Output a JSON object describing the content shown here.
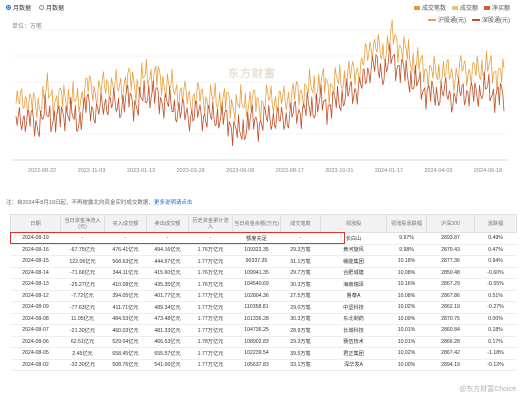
{
  "view_toggle": {
    "options": [
      "月数据",
      "月数据"
    ],
    "selected_index": 0
  },
  "legend_top": {
    "items": [
      {
        "label": "成交笔数",
        "color": "#e69a2e"
      },
      {
        "label": "成交额",
        "color": "#f0c080"
      },
      {
        "label": "净买额",
        "color": "#d05a3a"
      }
    ]
  },
  "legend_bottom": {
    "items": [
      {
        "label": "沪股通(元)",
        "color": "#e8a040"
      },
      {
        "label": "深股通(元)",
        "color": "#c0502a"
      }
    ]
  },
  "unit_label": "单位：万笔",
  "watermark_logo": "东方财富",
  "chart_data": {
    "type": "line",
    "xlabel": "",
    "ylabel": "",
    "x_ticks": [
      "2022-08-22",
      "2022-11-03",
      "2023-01-13",
      "2023-03-28",
      "2023-06-08",
      "2023-08-17",
      "2023-10-31",
      "2024-01-17",
      "2024-04-03",
      "2024-06-18"
    ],
    "series": [
      {
        "name": "沪股通(元)",
        "color": "#e8a040",
        "values": [
          0.45,
          0.5,
          0.42,
          0.55,
          0.48,
          0.52,
          0.46,
          0.6,
          0.55,
          0.62,
          0.58,
          0.65,
          0.6,
          0.7,
          0.66,
          0.6,
          0.55,
          0.5,
          0.52,
          0.48,
          0.5,
          0.46,
          0.44,
          0.48,
          0.45,
          0.5,
          0.47,
          0.52,
          0.55,
          0.58,
          0.62,
          0.6,
          0.65,
          0.7,
          0.75,
          0.95,
          0.85,
          1.0,
          0.9,
          0.8,
          0.75,
          0.7,
          0.72,
          0.68,
          0.74,
          0.7,
          0.76,
          0.72,
          0.68
        ]
      },
      {
        "name": "深股通(元)",
        "color": "#c0502a",
        "values": [
          0.3,
          0.35,
          0.28,
          0.38,
          0.32,
          0.4,
          0.3,
          0.45,
          0.38,
          0.48,
          0.42,
          0.5,
          0.44,
          0.55,
          0.5,
          0.45,
          0.4,
          0.36,
          0.38,
          0.34,
          0.36,
          0.3,
          0.2,
          0.32,
          0.3,
          0.35,
          0.32,
          0.36,
          0.4,
          0.42,
          0.46,
          0.44,
          0.5,
          0.55,
          0.6,
          0.78,
          0.7,
          0.82,
          0.72,
          0.64,
          0.58,
          0.52,
          0.55,
          0.5,
          0.56,
          0.52,
          0.58,
          0.54,
          0.5
        ]
      }
    ]
  },
  "note": {
    "text": "注：自2024年8月19日起，不再披露北向资金实时成交数据，",
    "link": "更多说明请点击"
  },
  "table": {
    "headers": [
      "日期",
      "当日资金净流入(元)",
      "买入成交额",
      "卖出成交额",
      "历史资金累计流入",
      "当日资金余额(万元)",
      "成交笔数",
      "领涨股",
      "领涨股涨跌幅",
      "沪深300",
      "涨跌幅"
    ],
    "rows": [
      [
        "2024-08-19",
        "-",
        "-",
        "-",
        "-",
        "额度充足",
        "-",
        "长白山",
        "9.97%",
        "2893.87",
        "0.49%"
      ],
      [
        "2024-08-16",
        "-67.75亿元",
        "476.41亿元",
        "494.16亿元",
        "1.76万亿元",
        "109322.35",
        "29.3万笔",
        "黄河旋风",
        "9.98%",
        "2879.43",
        "0.47%"
      ],
      [
        "2024-08-15",
        "122.06亿元",
        "568.63亿元",
        "444.57亿元",
        "1.77万亿元",
        "90337.35",
        "31.1万笔",
        "赣能集团",
        "10.18%",
        "2877.36",
        "0.94%"
      ],
      [
        "2024-08-14",
        "-71.66亿元",
        "344.11亿元",
        "415.60亿元",
        "1.76万亿元",
        "109941.35",
        "29.7万笔",
        "合肥城建",
        "10.08%",
        "2850.48",
        "-0.60%"
      ],
      [
        "2024-08-13",
        "-25.27亿元",
        "410.08亿元",
        "435.35亿元",
        "1.76万亿元",
        "104540.69",
        "30.3万笔",
        "海南瑞泽",
        "10.16%",
        "2867.29",
        "-0.55%"
      ],
      [
        "2024-08-12",
        "-7.72亿元",
        "394.05亿元",
        "401.77亿元",
        "1.77万亿元",
        "102804.36",
        "27.5万笔",
        "鲁泰A",
        "10.08%",
        "2867.86",
        "0.51%"
      ],
      [
        "2024-08-09",
        "-77.63亿元",
        "411.71亿元",
        "489.34亿元",
        "1.77万亿元",
        "110358.81",
        "29.0万笔",
        "中坚科技",
        "10.02%",
        "2862.19",
        "-0.27%"
      ],
      [
        "2024-08-08",
        "11.05亿元",
        "484.53亿元",
        "473.48亿元",
        "1.77万亿元",
        "101336.28",
        "30.3万笔",
        "东北制药",
        "10.09%",
        "2870.75",
        "0.00%"
      ],
      [
        "2024-08-07",
        "-21.30亿元",
        "460.03亿元",
        "481.33亿元",
        "1.77万亿元",
        "104736.25",
        "28.9万笔",
        "长城科技",
        "10.01%",
        "2860.84",
        "0.18%"
      ],
      [
        "2024-08-06",
        "62.51亿元",
        "529.04亿元",
        "466.53亿元",
        "1.78万亿元",
        "108902.83",
        "29.3万笔",
        "赛伍技术",
        "10.01%",
        "2866.28",
        "0.17%"
      ],
      [
        "2024-08-05",
        "2.45亿元",
        "658.45亿元",
        "655.57亿元",
        "1.77万亿元",
        "102239.54",
        "39.5万笔",
        "君正集团",
        "10.02%",
        "2867.42",
        "-1.18%"
      ],
      [
        "2024-08-02",
        "-32.30亿元",
        "508.76亿元",
        "541.06亿元",
        "1.77万亿元",
        "105637.83",
        "33.1万笔",
        "深华发A",
        "10.00%",
        "2894.19",
        "-0.12%"
      ]
    ]
  },
  "weibo_watermark": "@东方财富Choice"
}
